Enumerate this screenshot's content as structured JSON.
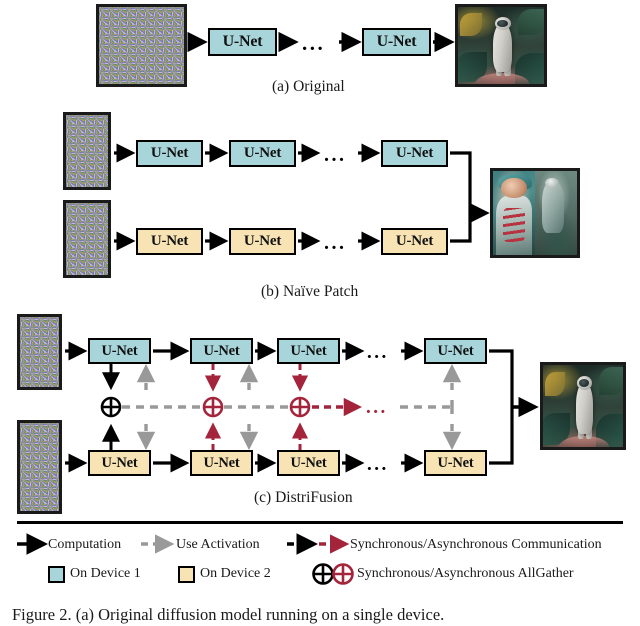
{
  "figure": {
    "caption": "Figure 2. (a) Original diffusion model running on a single device.",
    "separator_color": "#000000"
  },
  "colors": {
    "device1": "#a8d5da",
    "device2": "#f7e3b4",
    "computation": "#000000",
    "use_activation": "#999999",
    "sync_comm": "#000000",
    "async_comm": "#a4243b",
    "border": "#000000"
  },
  "panels": [
    {
      "id": "a",
      "label": "(a) Original",
      "unet_label": "U-Net",
      "rows": [
        {
          "device": "device1",
          "input_name": "noise-image",
          "blocks": [
            "U-Net",
            "U-Net"
          ],
          "output_name": "astronaut-jungle-image"
        }
      ],
      "ellipsis": "..."
    },
    {
      "id": "b",
      "label": "(b) Naïve Patch",
      "unet_label": "U-Net",
      "rows": [
        {
          "device": "device1",
          "input_name": "noise-patch-top",
          "blocks": [
            "U-Net",
            "U-Net",
            "U-Net"
          ]
        },
        {
          "device": "device2",
          "input_name": "noise-patch-bottom",
          "blocks": [
            "U-Net",
            "U-Net",
            "U-Net"
          ]
        }
      ],
      "output_name": "astronaut-seam-image",
      "ellipsis": "..."
    },
    {
      "id": "c",
      "label": "(c) DistriFusion",
      "unet_label": "U-Net",
      "rows": [
        {
          "device": "device1",
          "input_name": "noise-patch-top",
          "blocks": [
            "U-Net",
            "U-Net",
            "U-Net",
            "U-Net"
          ]
        },
        {
          "device": "device2",
          "input_name": "noise-patch-bottom",
          "blocks": [
            "U-Net",
            "U-Net",
            "U-Net",
            "U-Net"
          ]
        }
      ],
      "allgather_nodes": [
        {
          "kind": "synchronous",
          "symbol": "⊕"
        },
        {
          "kind": "asynchronous",
          "symbol": "⊕"
        },
        {
          "kind": "asynchronous",
          "symbol": "⊕"
        }
      ],
      "output_name": "astronaut-jungle-image",
      "ellipsis": "..."
    }
  ],
  "legend": {
    "row1": [
      {
        "icon": "solid-black-arrow-icon",
        "label": "Computation"
      },
      {
        "icon": "dashed-gray-arrow-icon",
        "label": "Use Activation"
      },
      {
        "icon": "dashed-black-red-arrow-icon",
        "label": "Synchronous/Asynchronous Communication"
      }
    ],
    "row2": [
      {
        "icon": "teal-square-swatch-icon",
        "label": "On Device 1"
      },
      {
        "icon": "cream-square-swatch-icon",
        "label": "On Device 2"
      },
      {
        "icon": "crossed-circle-pair-icon",
        "label": "Synchronous/Asynchronous AllGather"
      }
    ]
  }
}
